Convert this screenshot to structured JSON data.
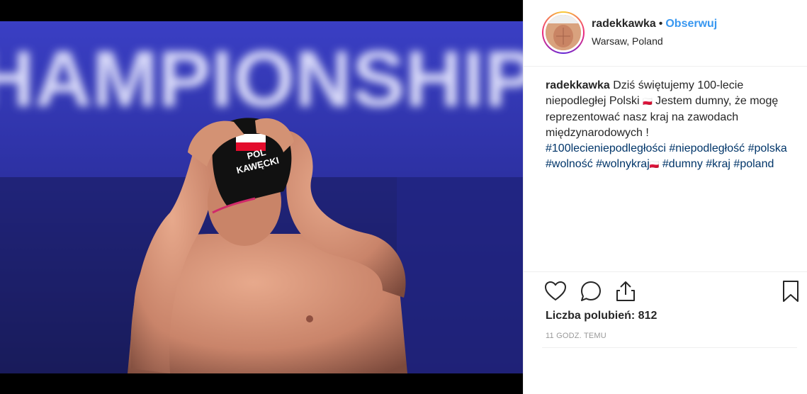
{
  "post": {
    "username": "radekkawka",
    "separator": "•",
    "follow_label": "Obserwuj",
    "location": "Warsaw, Poland"
  },
  "photo": {
    "banner_text": "CHAMPIONSHIPS",
    "cap_line1": "POL",
    "cap_line2": "KAWĘCKI"
  },
  "caption": {
    "username": "radekkawka",
    "text": "Dziś świętujemy 100-lecie niepodległej Polski 🇵🇱 Jestem dumny, że mogę reprezentować nasz kraj na zawodach międzynarodowych !",
    "text_before_flag": "Dziś świętujemy 100-lecie niepodległej Polski",
    "flag_1": "PL",
    "text_after_flag": "Jestem dumny, że mogę reprezentować nasz kraj na zawodach międzynarodowych !",
    "hashtags": [
      "#100lecieniepodległości",
      "#niepodległość",
      "#polska",
      "#wolność",
      "#wolnykraj",
      "#dumny",
      "#kraj",
      "#poland"
    ],
    "flag_2": "PL"
  },
  "actions": {
    "like_icon": "heart-outline-icon",
    "comment_icon": "comment-bubble-icon",
    "share_icon": "share-upload-icon",
    "save_icon": "bookmark-outline-icon"
  },
  "likes_text": "Liczba polubień: 812",
  "timestamp": "11 GODZ. TEMU",
  "colors": {
    "link": "#3897f0",
    "hashtag": "#003569",
    "border": "#efefef",
    "muted": "#999999",
    "photo_background": "#2a2fa0"
  }
}
